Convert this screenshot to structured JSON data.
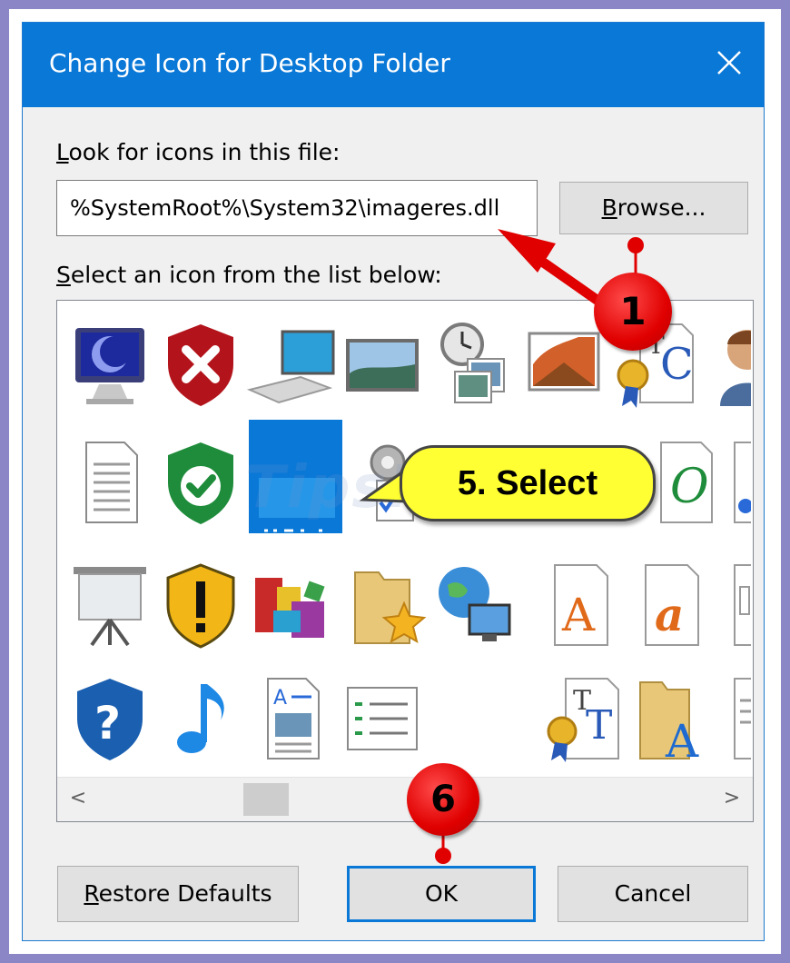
{
  "dialog": {
    "title": "Change Icon for Desktop Folder",
    "close_glyph": "✕"
  },
  "file_section": {
    "label_accel": "L",
    "label_rest": "ook for icons in this file:",
    "path_value": "%SystemRoot%\\System32\\imageres.dll",
    "browse_accel": "B",
    "browse_rest": "rowse..."
  },
  "list_section": {
    "label_accel": "S",
    "label_rest": "elect an icon from the list below:",
    "icons_row1": [
      "monitor-icon",
      "shield-error-icon",
      "computer-keyboard-icon",
      "landscape-picture-icon",
      "clock-pictures-icon",
      "photo-edit-icon",
      "certificate-doc-icon",
      "user-icon"
    ],
    "icons_row2": [
      "text-document-icon",
      "shield-check-icon",
      "desktop-folder-icon",
      "settings-checklist-icon",
      "hidden-icon",
      "hidden-icon",
      "open-type-icon",
      "partial-icon"
    ],
    "icons_row3": [
      "projector-screen-icon",
      "shield-warning-icon",
      "blocks-icon",
      "star-folder-icon",
      "network-globe-icon",
      "font-a-icon",
      "font-a-italic-icon",
      "partial-icon"
    ],
    "icons_row4": [
      "shield-question-icon",
      "music-note-icon",
      "document-image-icon",
      "checklist-icon",
      "blank-icon",
      "truetype-icon",
      "font-folder-icon",
      "partial-icon"
    ],
    "scroll_left": "<",
    "scroll_right": ">",
    "watermark": "TipsMake"
  },
  "buttons": {
    "restore_accel": "R",
    "restore_rest": "estore Defaults",
    "ok": "OK",
    "cancel": "Cancel"
  },
  "annotations": {
    "marker1": "1",
    "marker6": "6",
    "callout": "5. Select",
    "marker_color": "#e00000",
    "callout_color": "#ffff33"
  }
}
